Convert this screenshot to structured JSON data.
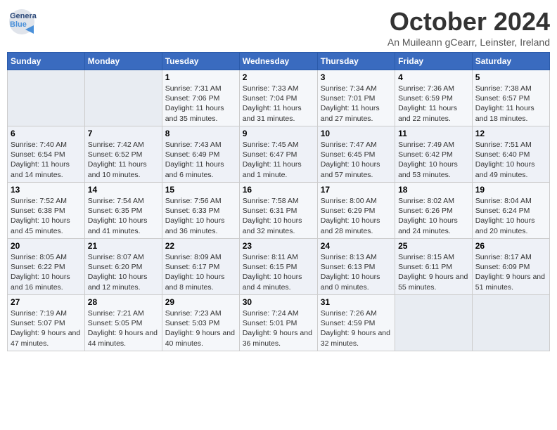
{
  "logo": {
    "line1": "General",
    "line2": "Blue"
  },
  "title": "October 2024",
  "location": "An Muileann gCearr, Leinster, Ireland",
  "days_of_week": [
    "Sunday",
    "Monday",
    "Tuesday",
    "Wednesday",
    "Thursday",
    "Friday",
    "Saturday"
  ],
  "weeks": [
    [
      {
        "day": "",
        "info": ""
      },
      {
        "day": "",
        "info": ""
      },
      {
        "day": "1",
        "info": "Sunrise: 7:31 AM\nSunset: 7:06 PM\nDaylight: 11 hours and 35 minutes."
      },
      {
        "day": "2",
        "info": "Sunrise: 7:33 AM\nSunset: 7:04 PM\nDaylight: 11 hours and 31 minutes."
      },
      {
        "day": "3",
        "info": "Sunrise: 7:34 AM\nSunset: 7:01 PM\nDaylight: 11 hours and 27 minutes."
      },
      {
        "day": "4",
        "info": "Sunrise: 7:36 AM\nSunset: 6:59 PM\nDaylight: 11 hours and 22 minutes."
      },
      {
        "day": "5",
        "info": "Sunrise: 7:38 AM\nSunset: 6:57 PM\nDaylight: 11 hours and 18 minutes."
      }
    ],
    [
      {
        "day": "6",
        "info": "Sunrise: 7:40 AM\nSunset: 6:54 PM\nDaylight: 11 hours and 14 minutes."
      },
      {
        "day": "7",
        "info": "Sunrise: 7:42 AM\nSunset: 6:52 PM\nDaylight: 11 hours and 10 minutes."
      },
      {
        "day": "8",
        "info": "Sunrise: 7:43 AM\nSunset: 6:49 PM\nDaylight: 11 hours and 6 minutes."
      },
      {
        "day": "9",
        "info": "Sunrise: 7:45 AM\nSunset: 6:47 PM\nDaylight: 11 hours and 1 minute."
      },
      {
        "day": "10",
        "info": "Sunrise: 7:47 AM\nSunset: 6:45 PM\nDaylight: 10 hours and 57 minutes."
      },
      {
        "day": "11",
        "info": "Sunrise: 7:49 AM\nSunset: 6:42 PM\nDaylight: 10 hours and 53 minutes."
      },
      {
        "day": "12",
        "info": "Sunrise: 7:51 AM\nSunset: 6:40 PM\nDaylight: 10 hours and 49 minutes."
      }
    ],
    [
      {
        "day": "13",
        "info": "Sunrise: 7:52 AM\nSunset: 6:38 PM\nDaylight: 10 hours and 45 minutes."
      },
      {
        "day": "14",
        "info": "Sunrise: 7:54 AM\nSunset: 6:35 PM\nDaylight: 10 hours and 41 minutes."
      },
      {
        "day": "15",
        "info": "Sunrise: 7:56 AM\nSunset: 6:33 PM\nDaylight: 10 hours and 36 minutes."
      },
      {
        "day": "16",
        "info": "Sunrise: 7:58 AM\nSunset: 6:31 PM\nDaylight: 10 hours and 32 minutes."
      },
      {
        "day": "17",
        "info": "Sunrise: 8:00 AM\nSunset: 6:29 PM\nDaylight: 10 hours and 28 minutes."
      },
      {
        "day": "18",
        "info": "Sunrise: 8:02 AM\nSunset: 6:26 PM\nDaylight: 10 hours and 24 minutes."
      },
      {
        "day": "19",
        "info": "Sunrise: 8:04 AM\nSunset: 6:24 PM\nDaylight: 10 hours and 20 minutes."
      }
    ],
    [
      {
        "day": "20",
        "info": "Sunrise: 8:05 AM\nSunset: 6:22 PM\nDaylight: 10 hours and 16 minutes."
      },
      {
        "day": "21",
        "info": "Sunrise: 8:07 AM\nSunset: 6:20 PM\nDaylight: 10 hours and 12 minutes."
      },
      {
        "day": "22",
        "info": "Sunrise: 8:09 AM\nSunset: 6:17 PM\nDaylight: 10 hours and 8 minutes."
      },
      {
        "day": "23",
        "info": "Sunrise: 8:11 AM\nSunset: 6:15 PM\nDaylight: 10 hours and 4 minutes."
      },
      {
        "day": "24",
        "info": "Sunrise: 8:13 AM\nSunset: 6:13 PM\nDaylight: 10 hours and 0 minutes."
      },
      {
        "day": "25",
        "info": "Sunrise: 8:15 AM\nSunset: 6:11 PM\nDaylight: 9 hours and 55 minutes."
      },
      {
        "day": "26",
        "info": "Sunrise: 8:17 AM\nSunset: 6:09 PM\nDaylight: 9 hours and 51 minutes."
      }
    ],
    [
      {
        "day": "27",
        "info": "Sunrise: 7:19 AM\nSunset: 5:07 PM\nDaylight: 9 hours and 47 minutes."
      },
      {
        "day": "28",
        "info": "Sunrise: 7:21 AM\nSunset: 5:05 PM\nDaylight: 9 hours and 44 minutes."
      },
      {
        "day": "29",
        "info": "Sunrise: 7:23 AM\nSunset: 5:03 PM\nDaylight: 9 hours and 40 minutes."
      },
      {
        "day": "30",
        "info": "Sunrise: 7:24 AM\nSunset: 5:01 PM\nDaylight: 9 hours and 36 minutes."
      },
      {
        "day": "31",
        "info": "Sunrise: 7:26 AM\nSunset: 4:59 PM\nDaylight: 9 hours and 32 minutes."
      },
      {
        "day": "",
        "info": ""
      },
      {
        "day": "",
        "info": ""
      }
    ]
  ]
}
